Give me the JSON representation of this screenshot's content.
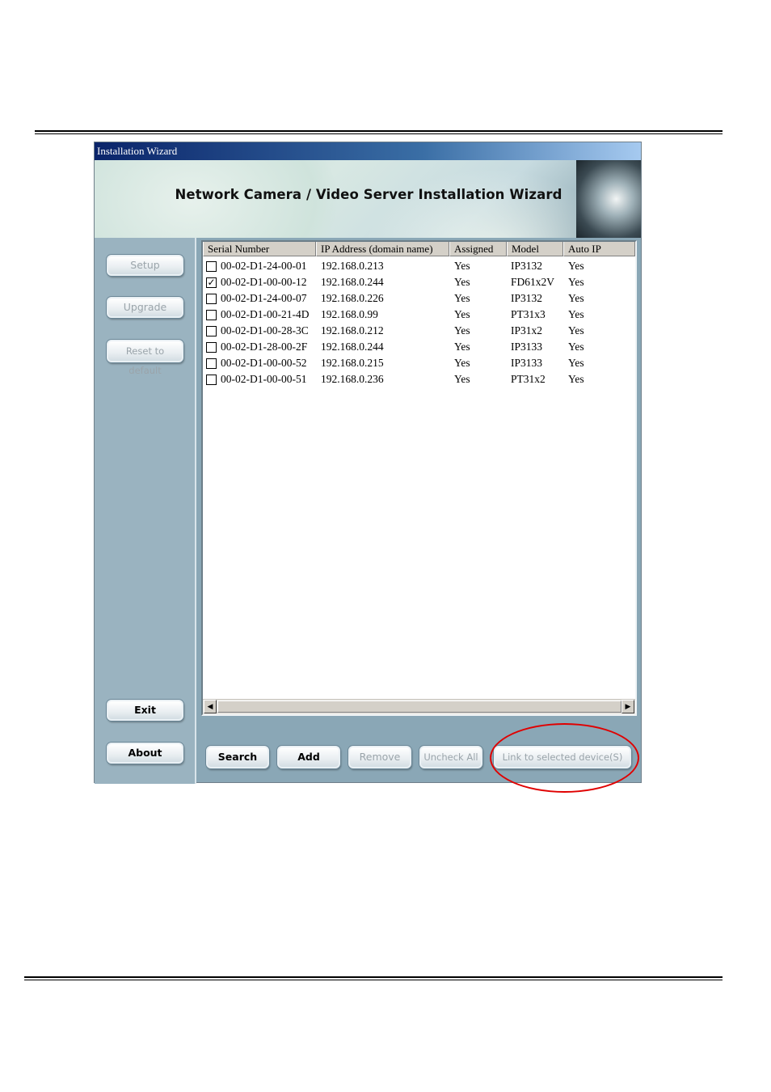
{
  "window": {
    "title": "Installation Wizard",
    "banner_title": "Network Camera / Video Server Installation Wizard"
  },
  "sidebar": {
    "setup_label": "Setup",
    "upgrade_label": "Upgrade",
    "reset_label": "Reset to default",
    "exit_label": "Exit",
    "about_label": "About"
  },
  "table": {
    "columns": [
      "Serial Number",
      "IP Address (domain name)",
      "Assigned",
      "Model",
      "Auto IP"
    ],
    "rows": [
      {
        "checked": false,
        "serial": "00-02-D1-24-00-01",
        "ip": "192.168.0.213",
        "assigned": "Yes",
        "model": "IP3132",
        "auto_ip": "Yes"
      },
      {
        "checked": true,
        "serial": "00-02-D1-00-00-12",
        "ip": "192.168.0.244",
        "assigned": "Yes",
        "model": "FD61x2V",
        "auto_ip": "Yes"
      },
      {
        "checked": false,
        "serial": "00-02-D1-24-00-07",
        "ip": "192.168.0.226",
        "assigned": "Yes",
        "model": "IP3132",
        "auto_ip": "Yes"
      },
      {
        "checked": false,
        "serial": "00-02-D1-00-21-4D",
        "ip": "192.168.0.99",
        "assigned": "Yes",
        "model": "PT31x3",
        "auto_ip": "Yes"
      },
      {
        "checked": false,
        "serial": "00-02-D1-00-28-3C",
        "ip": "192.168.0.212",
        "assigned": "Yes",
        "model": "IP31x2",
        "auto_ip": "Yes"
      },
      {
        "checked": false,
        "serial": "00-02-D1-28-00-2F",
        "ip": "192.168.0.244",
        "assigned": "Yes",
        "model": "IP3133",
        "auto_ip": "Yes"
      },
      {
        "checked": false,
        "serial": "00-02-D1-00-00-52",
        "ip": "192.168.0.215",
        "assigned": "Yes",
        "model": "IP3133",
        "auto_ip": "Yes"
      },
      {
        "checked": false,
        "serial": "00-02-D1-00-00-51",
        "ip": "192.168.0.236",
        "assigned": "Yes",
        "model": "PT31x2",
        "auto_ip": "Yes"
      }
    ]
  },
  "bottom_bar": {
    "search_label": "Search",
    "add_label": "Add",
    "remove_label": "Remove",
    "uncheck_all_label": "Uncheck All",
    "link_label": "Link to selected device(S)"
  },
  "icons": {
    "check": "✓",
    "scroll_left": "◀",
    "scroll_right": "▶"
  },
  "colors": {
    "highlight": "#e00000",
    "panel": "#9ab3c0"
  }
}
